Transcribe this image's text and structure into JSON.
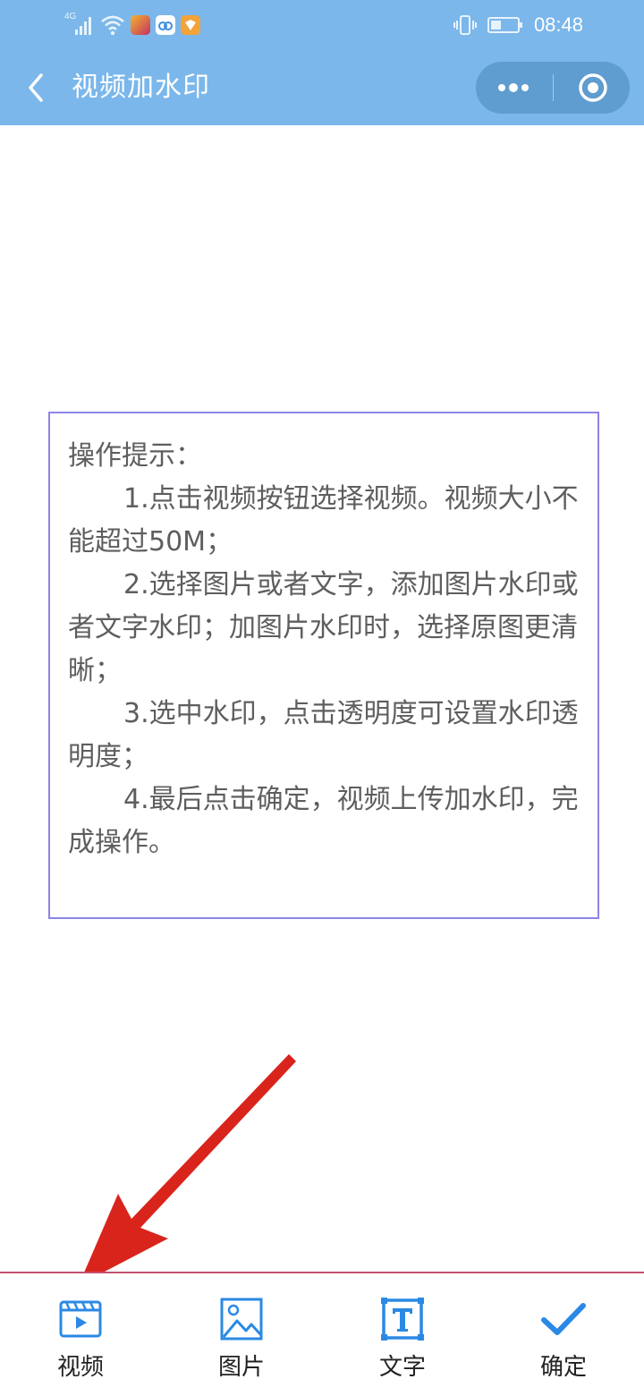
{
  "status_bar": {
    "network_label": "4G",
    "time": "08:48",
    "app_icons": [
      "game-app-icon",
      "cloud-app-icon",
      "shield-app-icon"
    ]
  },
  "nav": {
    "title": "视频加水印",
    "back_icon": "chevron-left-icon",
    "more_icon": "more-dots-icon",
    "close_icon": "target-circle-icon"
  },
  "tips": {
    "heading": "操作提示：",
    "steps": [
      "1.点击视频按钮选择视频。视频大小不能超过50M；",
      "2.选择图片或者文字，添加图片水印或者文字水印；加图片水印时，选择原图更清晰；",
      "3.选中水印，点击透明度可设置水印透明度；",
      "4.最后点击确定，视频上传加水印，完成操作。"
    ]
  },
  "toolbar": {
    "items": [
      {
        "label": "视频",
        "icon": "video-clapper-icon"
      },
      {
        "label": "图片",
        "icon": "image-icon"
      },
      {
        "label": "文字",
        "icon": "text-box-icon"
      },
      {
        "label": "确定",
        "icon": "checkmark-icon"
      }
    ]
  },
  "colors": {
    "header_bg": "#7bb7ea",
    "capsule_bg": "#5f9ccf",
    "tip_border": "#8d84e6",
    "tip_text": "#5e5e5e",
    "icon_blue": "#2a89e4",
    "annotation_arrow": "#d9241c",
    "toolbar_divider": "#c3506f"
  }
}
